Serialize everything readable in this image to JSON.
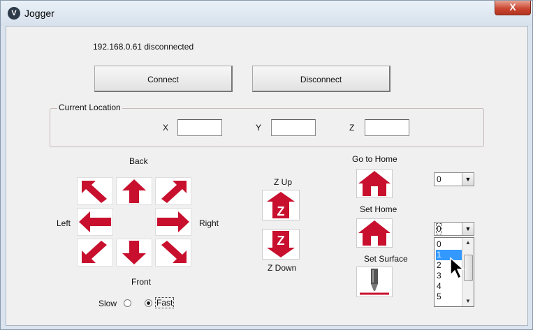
{
  "window": {
    "title": "Jogger",
    "app_icon": "jogger-logo-icon",
    "close_glyph": "X"
  },
  "status": "192.168.0.61  disconnected",
  "buttons": {
    "connect": "Connect",
    "disconnect": "Disconnect"
  },
  "current_location": {
    "label": "Current Location",
    "x_label": "X",
    "x_value": "",
    "y_label": "Y",
    "y_value": "",
    "z_label": "Z",
    "z_value": ""
  },
  "jog": {
    "back": "Back",
    "front": "Front",
    "left": "Left",
    "right": "Right",
    "z_up": "Z Up",
    "z_down": "Z Down",
    "z_glyph": "Z",
    "arrow_color": "#c8102e"
  },
  "speed": {
    "slow": "Slow",
    "fast": "Fast",
    "selected": "Fast"
  },
  "home": {
    "go_to_home": "Go to Home",
    "set_home": "Set Home",
    "set_surface": "Set Surface"
  },
  "combo1": {
    "value": "0"
  },
  "combo2": {
    "value": "0",
    "options": [
      "0",
      "1",
      "2",
      "3",
      "4",
      "5"
    ],
    "highlighted": "1"
  }
}
